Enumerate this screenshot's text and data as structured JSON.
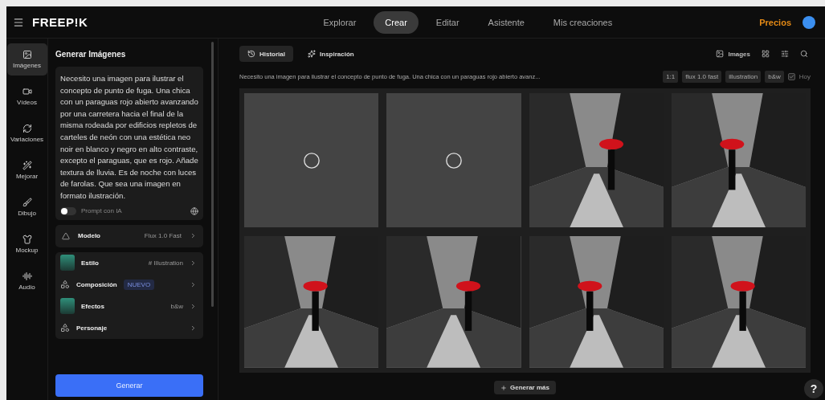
{
  "topbar": {
    "logo": "FREEP!K",
    "nav": [
      {
        "label": "Explorar",
        "selected": false
      },
      {
        "label": "Crear",
        "selected": true
      },
      {
        "label": "Editar",
        "selected": false
      },
      {
        "label": "Asistente",
        "selected": false
      },
      {
        "label": "Mis creaciones",
        "selected": false
      }
    ],
    "pricing": "Precios"
  },
  "rail": [
    {
      "label": "Imágenes",
      "selected": true
    },
    {
      "label": "Vídeos",
      "selected": false
    },
    {
      "label": "Variaciones",
      "selected": false
    },
    {
      "label": "Mejorar",
      "selected": false
    },
    {
      "label": "Dibujo",
      "selected": false
    },
    {
      "label": "Mockup",
      "selected": false
    },
    {
      "label": "Audio",
      "selected": false
    }
  ],
  "panel": {
    "title": "Generar Imágenes",
    "prompt": "Necesito una imagen para ilustrar el concepto de punto de fuga. Una chica con un paraguas rojo abierto avanzando por una carretera hacia el final de la misma rodeada por edificios repletos de carteles de neón con una estética neo noir en blanco y negro en alto contraste, excepto el paraguas, que es rojo. Añade textura de lluvia. Es de noche con luces de farolas. Que sea una imagen en formato ilustración.",
    "ai_prompt": {
      "label": "Prompt con IA",
      "on": false
    },
    "model": {
      "label": "Modelo",
      "value": "Flux 1.0 Fast"
    },
    "options": [
      {
        "kind": "thumb",
        "label": "Estilo",
        "value": "# Illustration"
      },
      {
        "kind": "icon",
        "label": "Composición",
        "badge": "NUEVO"
      },
      {
        "kind": "thumb",
        "label": "Efectos",
        "value": "b&w"
      },
      {
        "kind": "icon",
        "label": "Personaje"
      }
    ],
    "generate": "Generar"
  },
  "main": {
    "tabs": [
      {
        "label": "Historial",
        "selected": true
      },
      {
        "label": "Inspiración",
        "selected": false
      }
    ],
    "type_button": "Images",
    "prompt_line": "Necesito una imagen para ilustrar el concepto de punto de fuga. Una chica con un paraguas rojo abierto avanz...",
    "tags": [
      "1:1",
      "flux 1.0 fast",
      "illustration",
      "b&w"
    ],
    "date": {
      "label": "Hoy",
      "checked": true
    },
    "tiles": [
      {
        "kind": "loading"
      },
      {
        "kind": "loading"
      },
      {
        "kind": "image"
      },
      {
        "kind": "image"
      },
      {
        "kind": "image"
      },
      {
        "kind": "image"
      },
      {
        "kind": "image"
      },
      {
        "kind": "image"
      }
    ],
    "more": "Generar más",
    "help": "?"
  }
}
